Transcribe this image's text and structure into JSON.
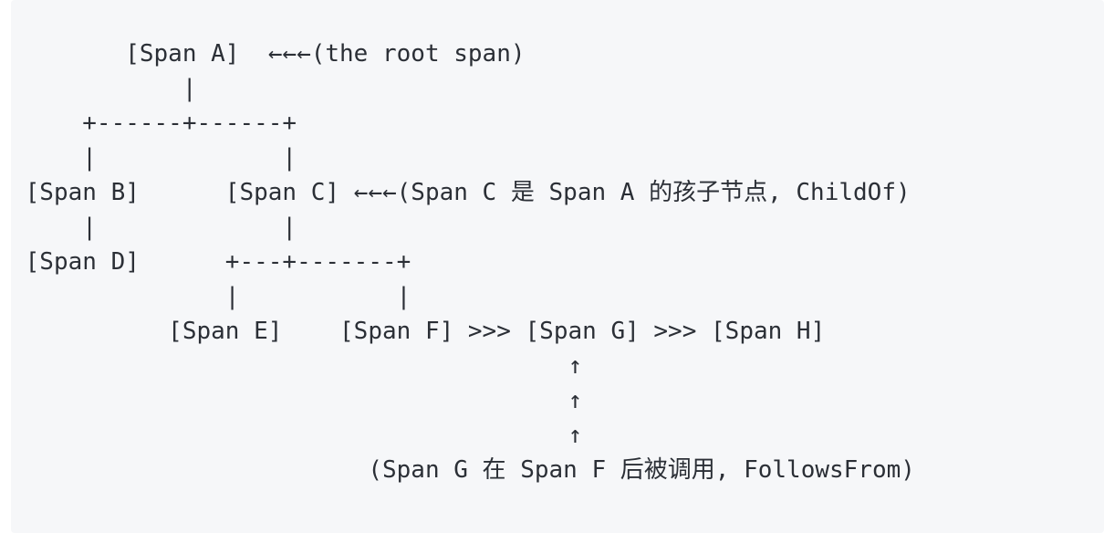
{
  "diagram": {
    "lines": [
      "        [Span A]  ←←←(the root span)",
      "            |",
      "     +------+------+",
      "     |             |",
      " [Span B]      [Span C] ←←←(Span C 是 Span A 的孩子节点, ChildOf)",
      "     |             |",
      " [Span D]      +---+-------+",
      "               |           |",
      "           [Span E]    [Span F] >>> [Span G] >>> [Span H]",
      "                                       ↑",
      "                                       ↑",
      "                                       ↑",
      "                         (Span G 在 Span F 后被调用, FollowsFrom)"
    ]
  }
}
